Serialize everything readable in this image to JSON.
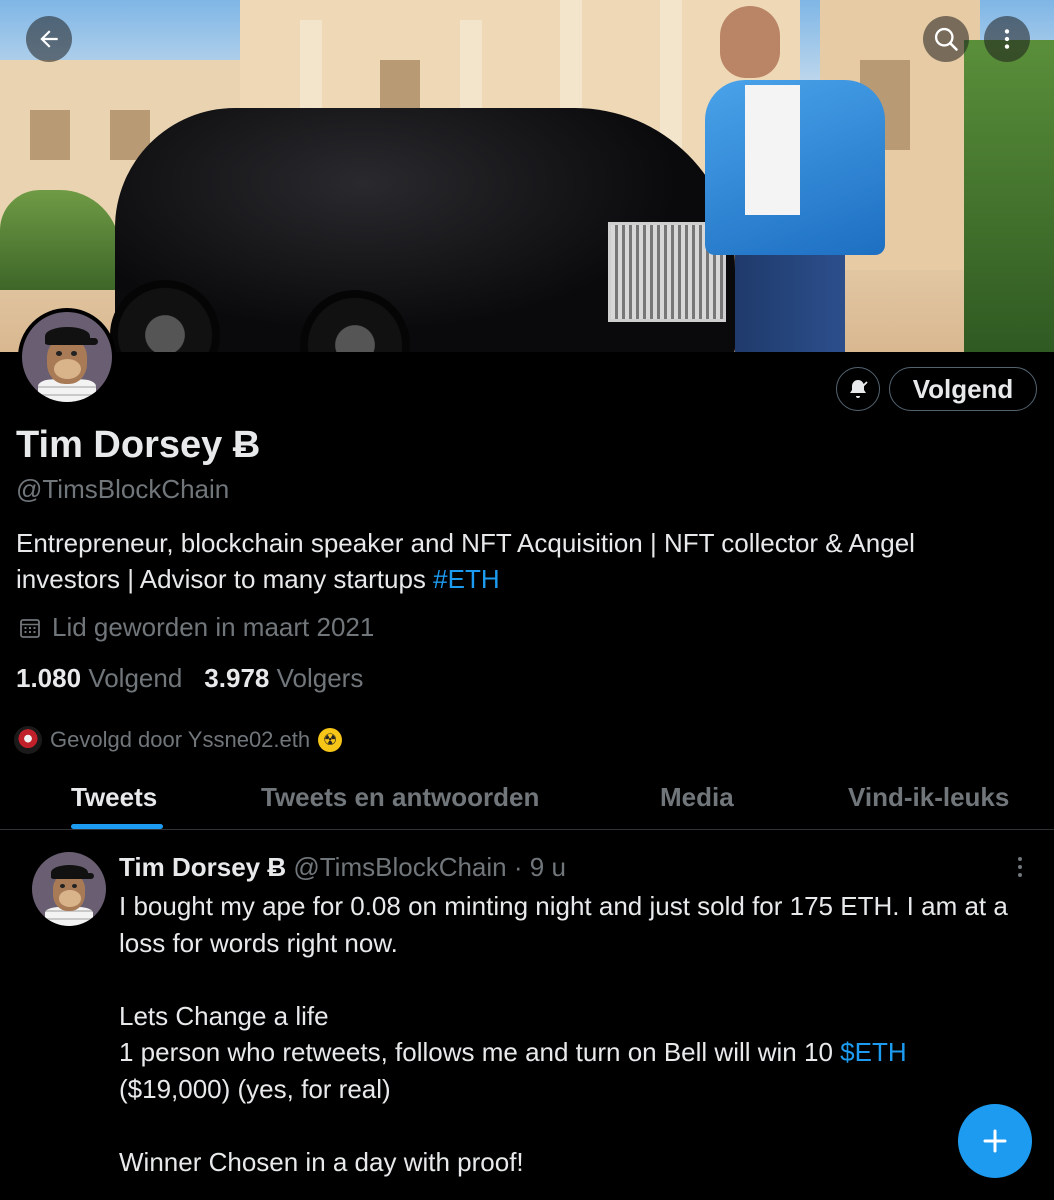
{
  "header": {
    "back_icon": "arrow-left-icon",
    "search_icon": "search-icon",
    "more_icon": "more-vertical-icon"
  },
  "profile": {
    "name": "Tim Dorsey Ƀ",
    "handle": "@TimsBlockChain",
    "bio_text": "Entrepreneur, blockchain speaker and NFT Acquisition | NFT collector & Angel investors |  Advisor to many startups ",
    "bio_hashtag": "#ETH",
    "joined": "Lid geworden in maart 2021",
    "following_count": "1.080",
    "following_label": "Volgend",
    "followers_count": "3.978",
    "followers_label": "Volgers",
    "followed_by": "Gevolgd door Yssne02.eth",
    "follow_button": "Volgend"
  },
  "tabs": [
    {
      "label": "Tweets",
      "active": true
    },
    {
      "label": "Tweets en antwoorden",
      "active": false
    },
    {
      "label": "Media",
      "active": false
    },
    {
      "label": "Vind-ik-leuks",
      "active": false
    }
  ],
  "tweet": {
    "author_name": "Tim Dorsey Ƀ",
    "author_handle": "@TimsBlockChain",
    "separator": "·",
    "time": "9 u",
    "line1": "I bought my ape for 0.08 on minting night and just sold for 175 ETH. I am at a loss for words right now.",
    "line2": "Lets Change a life",
    "line3_text": "1 person who retweets, follows me and turn on Bell will win 10 ",
    "line3_cashtag": "$ETH",
    "line4": "($19,000) (yes, for real)",
    "line5": "Winner Chosen in a day with proof!"
  },
  "colors": {
    "accent": "#1d9bf0",
    "background": "#000000",
    "secondary_text": "#71767b"
  }
}
